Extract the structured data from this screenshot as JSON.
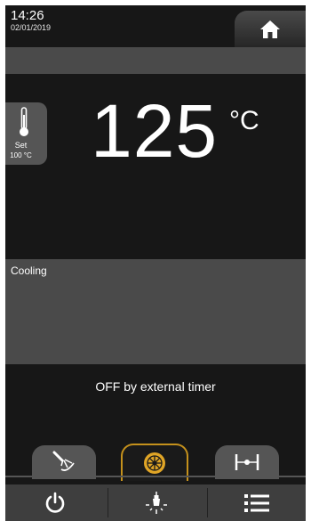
{
  "header": {
    "time": "14:26",
    "date": "02/01/2019",
    "home_icon": "home-icon"
  },
  "setpoint": {
    "icon": "thermometer-icon",
    "label": "Set",
    "value": "100 °C"
  },
  "temperature": {
    "value": "125",
    "unit": "°C"
  },
  "status": {
    "title": "Cooling"
  },
  "message": "OFF by external timer",
  "tabs": [
    {
      "icon": "spray-nozzle-icon",
      "active": false
    },
    {
      "icon": "fan-icon",
      "active": true
    },
    {
      "icon": "pin-width-icon",
      "active": false
    }
  ],
  "bottom_bar": [
    {
      "icon": "power-icon"
    },
    {
      "icon": "light-icon"
    },
    {
      "icon": "menu-icon"
    }
  ],
  "colors": {
    "background": "#171717",
    "panel": "#4a4a4a",
    "tab": "#555555",
    "accent": "#e0a526",
    "text": "#ffffff"
  }
}
